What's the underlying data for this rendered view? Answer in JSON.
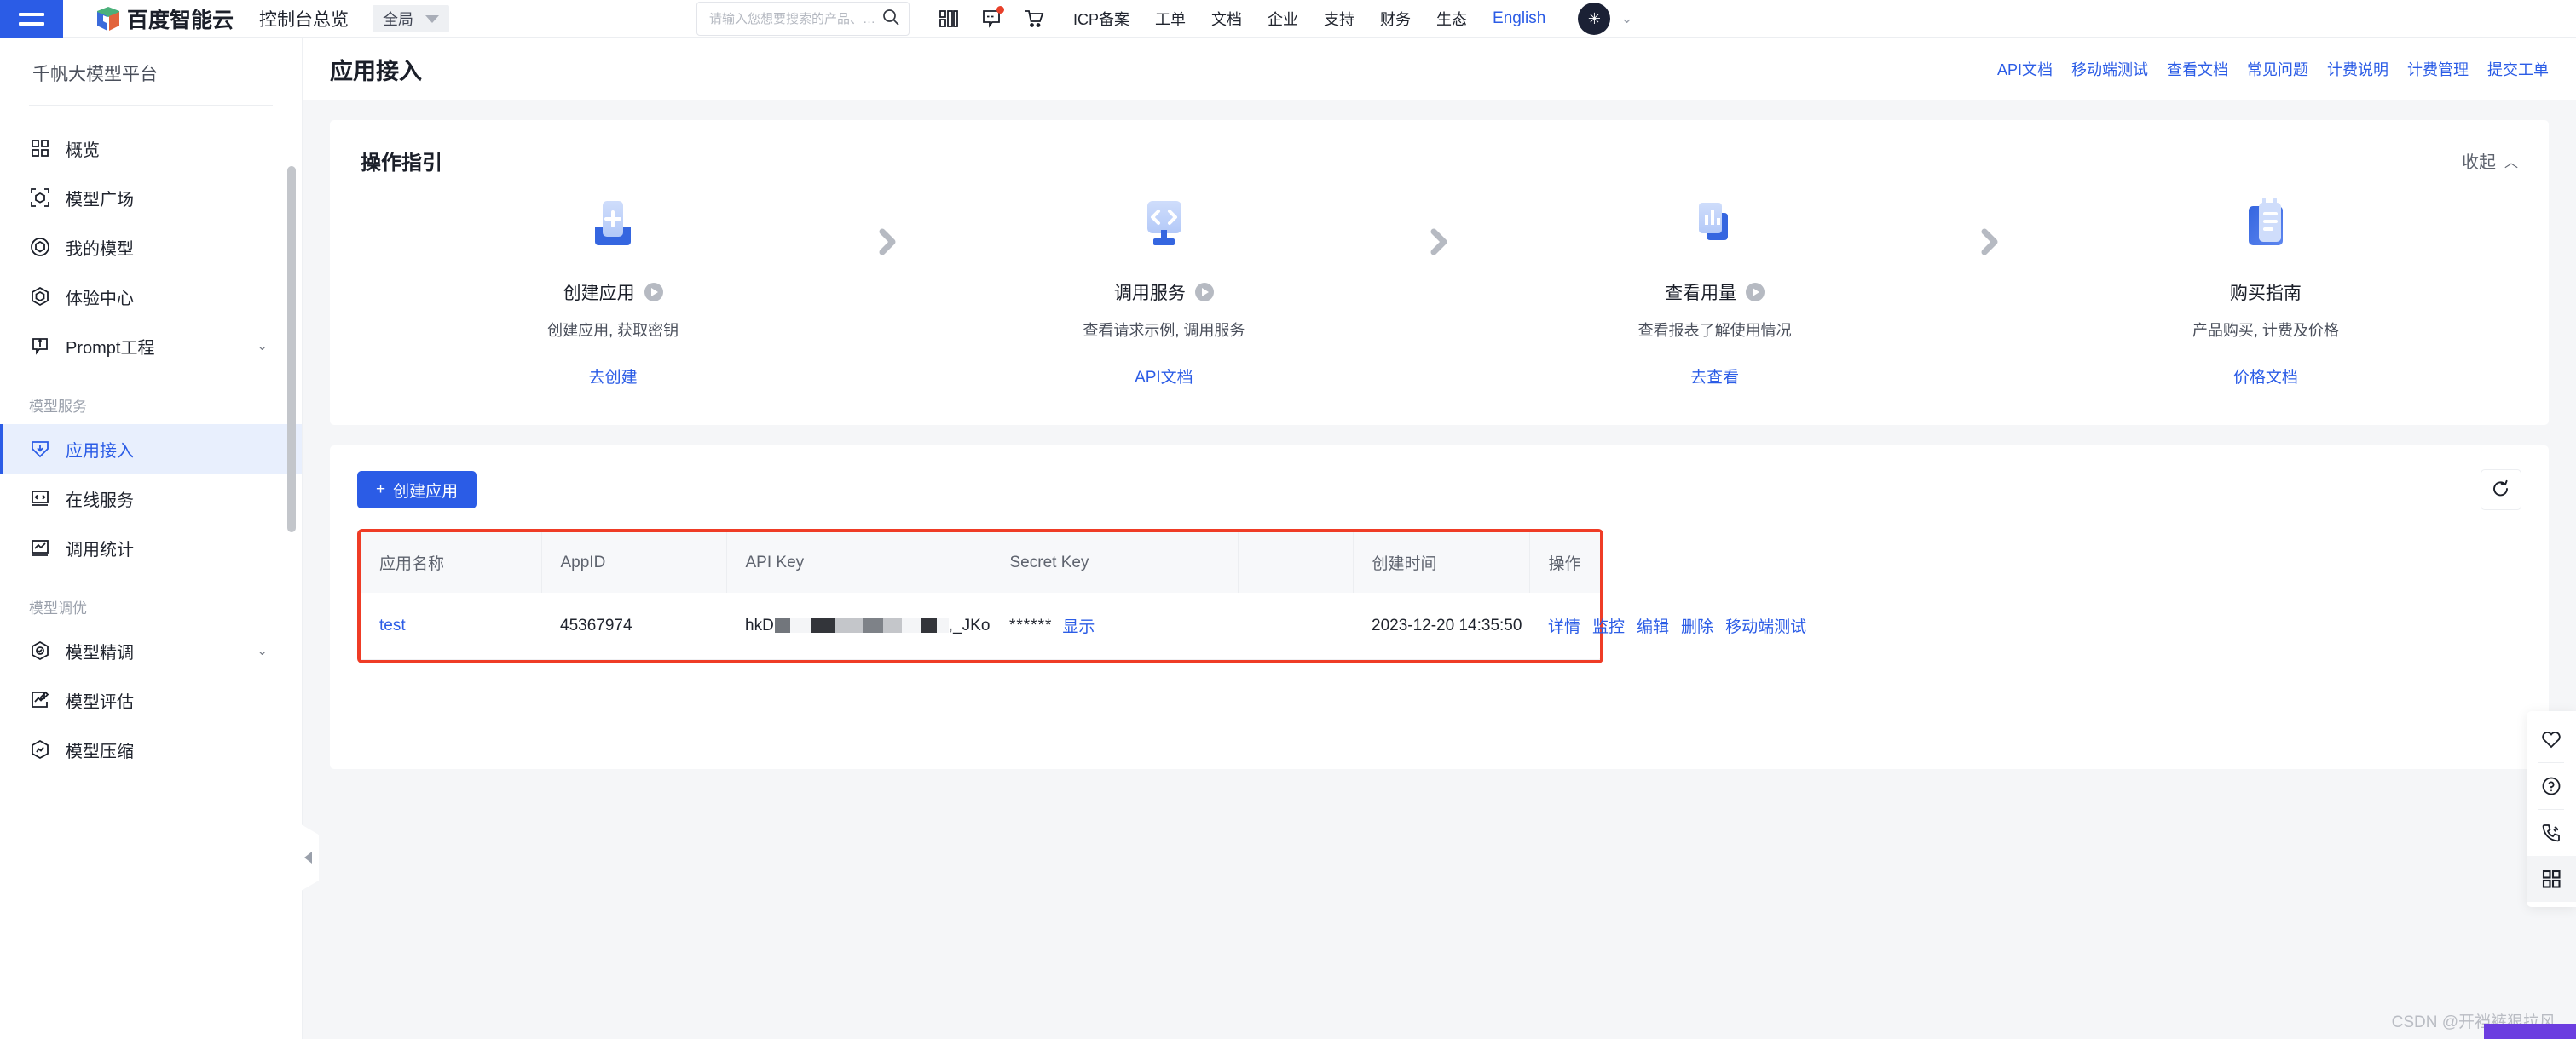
{
  "topbar": {
    "menu_icon": "hamburger-icon",
    "brand": "百度智能云",
    "console_title": "控制台总览",
    "region": "全局",
    "search_placeholder": "请输入您想要搜索的产品、…",
    "icons": [
      "apps-grid-icon",
      "message-icon",
      "cart-icon"
    ],
    "links": [
      "ICP备案",
      "工单",
      "文档",
      "企业",
      "支持",
      "财务",
      "生态"
    ],
    "english": "English",
    "avatar_glyph": "✳"
  },
  "sidebar": {
    "title": "千帆大模型平台",
    "items": [
      {
        "label": "概览",
        "icon": "grid-icon",
        "active": false,
        "expandable": false
      },
      {
        "label": "模型广场",
        "icon": "cube-scan-icon",
        "active": false,
        "expandable": false
      },
      {
        "label": "我的模型",
        "icon": "cube-circle-icon",
        "active": false,
        "expandable": false
      },
      {
        "label": "体验中心",
        "icon": "cube-hex-icon",
        "active": false,
        "expandable": false
      },
      {
        "label": "Prompt工程",
        "icon": "prompt-icon",
        "active": false,
        "expandable": true
      }
    ],
    "group_service": "模型服务",
    "service_items": [
      {
        "label": "应用接入",
        "icon": "download-shield-icon",
        "active": true,
        "expandable": false
      },
      {
        "label": "在线服务",
        "icon": "code-screen-icon",
        "active": false,
        "expandable": false
      },
      {
        "label": "调用统计",
        "icon": "chart-box-icon",
        "active": false,
        "expandable": false
      }
    ],
    "group_tuning": "模型调优",
    "tuning_items": [
      {
        "label": "模型精调",
        "icon": "target-hex-icon",
        "active": false,
        "expandable": true
      },
      {
        "label": "模型评估",
        "icon": "chart-pencil-icon",
        "active": false,
        "expandable": false
      },
      {
        "label": "模型压缩",
        "icon": "compress-hex-icon",
        "active": false,
        "expandable": false
      }
    ]
  },
  "page": {
    "title": "应用接入",
    "links": [
      "API文档",
      "移动端测试",
      "查看文档",
      "常见问题",
      "计费说明",
      "计费管理",
      "提交工单"
    ]
  },
  "guide": {
    "title": "操作指引",
    "collapse_label": "收起",
    "steps": [
      {
        "icon": "create-app-icon",
        "name": "创建应用",
        "desc": "创建应用, 获取密钥",
        "link": "去创建"
      },
      {
        "icon": "call-service-icon",
        "name": "调用服务",
        "desc": "查看请求示例, 调用服务",
        "link": "API文档"
      },
      {
        "icon": "view-usage-icon",
        "name": "查看用量",
        "desc": "查看报表了解使用情况",
        "link": "去查看"
      },
      {
        "icon": "purchase-guide-icon",
        "name": "购买指南",
        "desc": "产品购买, 计费及价格",
        "link": "价格文档"
      }
    ]
  },
  "list": {
    "create_button": "创建应用",
    "create_plus": "+",
    "refresh_icon": "refresh-icon",
    "columns": [
      "应用名称",
      "AppID",
      "API Key",
      "Secret Key",
      "",
      "创建时间",
      "操作"
    ],
    "rows": [
      {
        "name": "test",
        "appid": "45367974",
        "api_key_prefix": "hkD",
        "api_key_suffix": "_JKo",
        "secret_mask": "******",
        "secret_show": "显示",
        "created": "2023-12-20 14:35:50",
        "ops": [
          "详情",
          "监控",
          "编辑",
          "删除",
          "移动端测试"
        ]
      }
    ]
  },
  "float_bar": {
    "items": [
      "heart-icon",
      "question-icon",
      "phone-icon",
      "grid-apps-icon"
    ]
  },
  "watermark": "CSDN @开裆裤狠拉风",
  "colors": {
    "accent": "#2b5ce6",
    "highlight_border": "#ef3c26",
    "active_bg": "#e8effd",
    "page_bg": "#f5f6f8"
  }
}
